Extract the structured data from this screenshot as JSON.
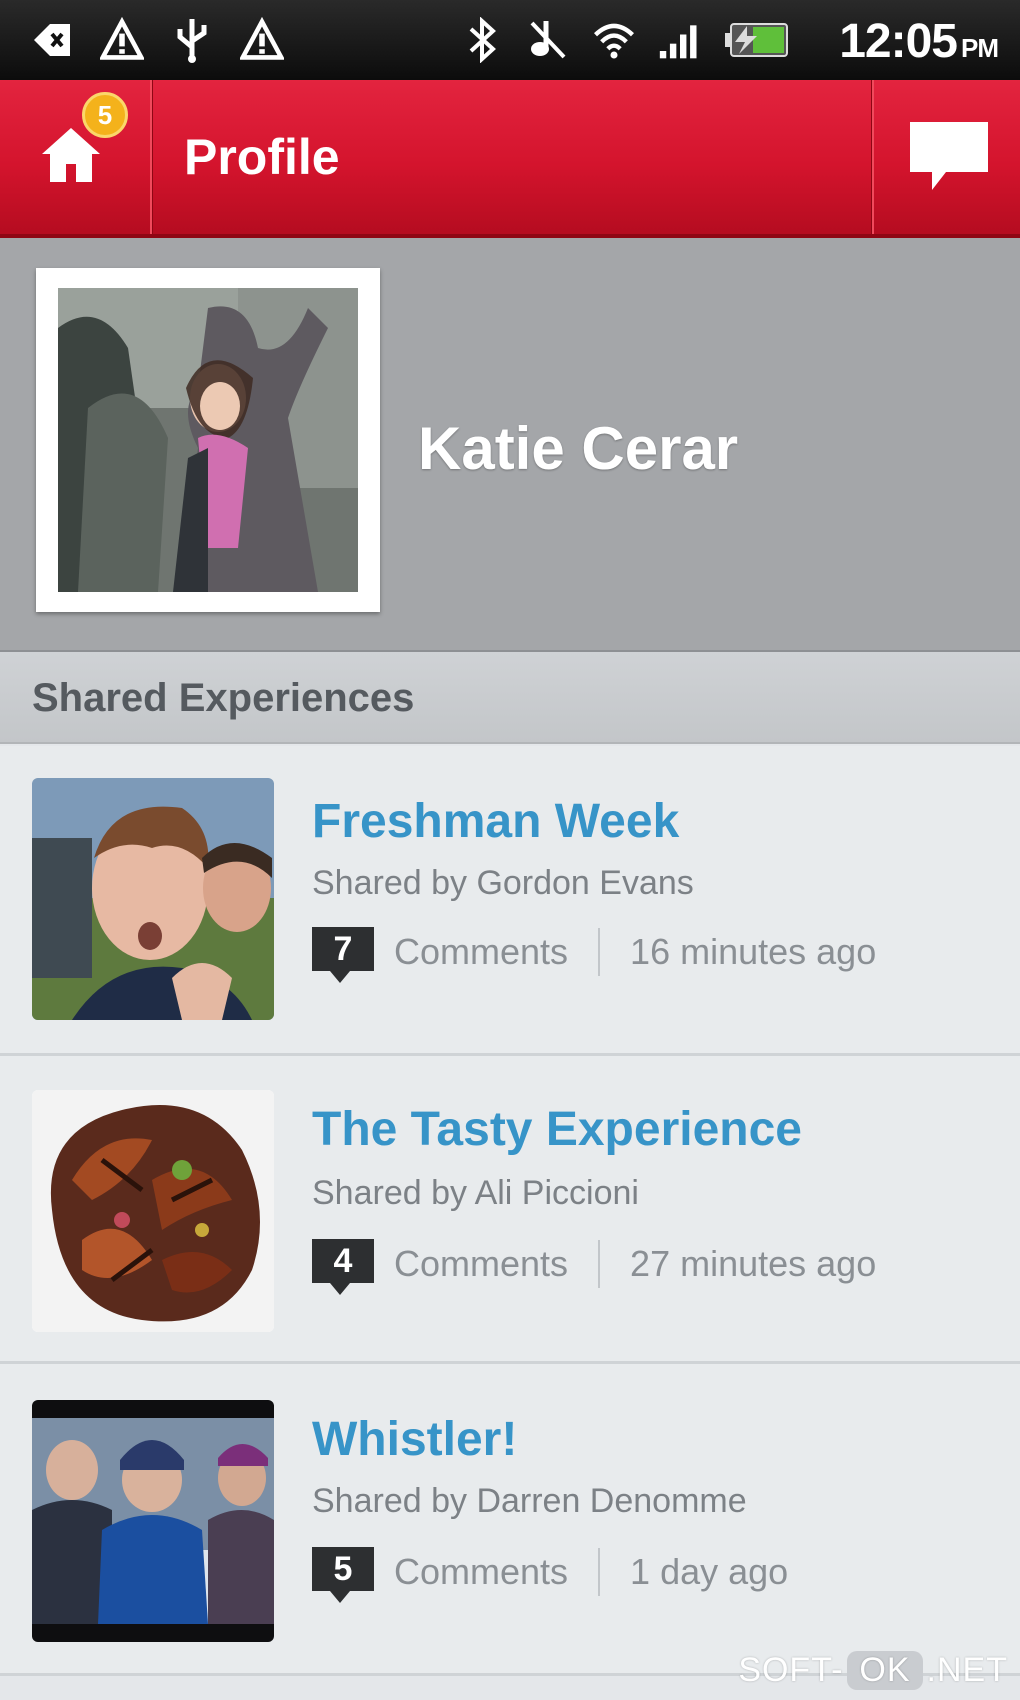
{
  "status_bar": {
    "time": "12:05",
    "ampm": "PM",
    "icons_left": [
      "back-arrow-icon",
      "warning-icon",
      "usb-icon",
      "warning-icon"
    ],
    "icons_right": [
      "bluetooth-icon",
      "vibrate-off-icon",
      "wifi-icon",
      "signal-icon",
      "battery-icon"
    ]
  },
  "action_bar": {
    "badge": "5",
    "title": "Profile",
    "color": "#d4142d"
  },
  "profile": {
    "name": "Katie Cerar"
  },
  "section": {
    "title": "Shared Experiences"
  },
  "items": [
    {
      "title": "Freshman Week",
      "shared_by": "Shared by Gordon Evans",
      "comment_count": "7",
      "comments_label": "Comments",
      "time_ago": "16 minutes ago"
    },
    {
      "title": "The Tasty Experience",
      "shared_by": "Shared by Ali Piccioni",
      "comment_count": "4",
      "comments_label": "Comments",
      "time_ago": "27 minutes ago"
    },
    {
      "title": "Whistler!",
      "shared_by": "Shared by Darren Denomme",
      "comment_count": "5",
      "comments_label": "Comments",
      "time_ago": "1 day ago"
    }
  ],
  "watermark": {
    "prefix": "SOFT-",
    "ok": "OK",
    "suffix": ".NET"
  },
  "colors": {
    "accent_red": "#d4142d",
    "title_blue": "#3794c8"
  }
}
